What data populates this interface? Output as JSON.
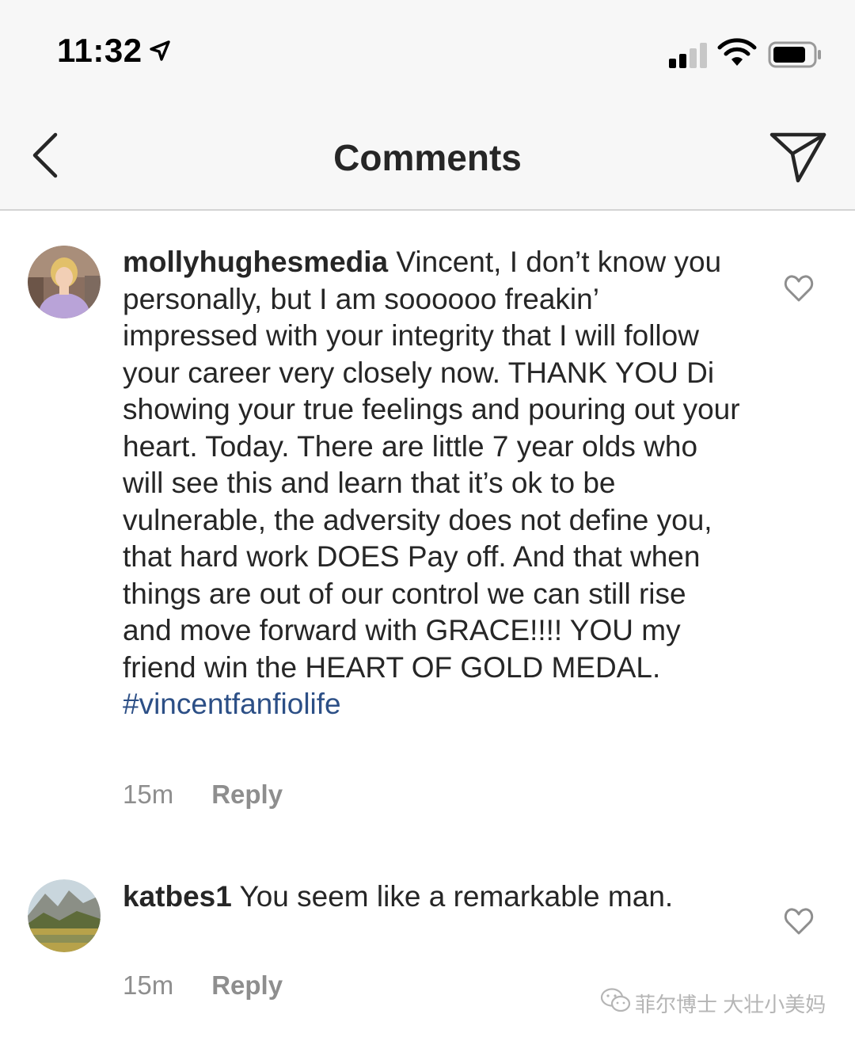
{
  "status_bar": {
    "time": "11:32"
  },
  "nav": {
    "title": "Comments"
  },
  "comments": [
    {
      "username": "mollyhughesmedia",
      "text": "Vincent, I don’t know you personally, but I am soooooo freakin’ impressed with your integrity that I will follow your career very closely now. THANK YOU Di showing your true feelings and pouring out your heart. Today. There are little 7 year olds who will see this and learn that it’s ok to be vulnerable, the adversity does not define you, that hard work DOES Pay off. And that when things are out of our control we can still rise and move forward with GRACE!!!! YOU my friend win the HEART OF GOLD MEDAL.",
      "hashtag": "#vincentfanfiolife",
      "time": "15m",
      "reply_label": "Reply"
    },
    {
      "username": "katbes1",
      "text": "You seem like a remarkable man.",
      "time": "15m",
      "reply_label": "Reply"
    }
  ],
  "watermark": {
    "text": "菲尔博士 大壮小美妈"
  },
  "colors": {
    "hashtag": "#2c4f86",
    "meta": "#8e8e8e",
    "text": "#262626",
    "bar_bg": "#f7f7f7"
  },
  "icons": [
    "location-arrow-icon",
    "cellular-signal-icon",
    "wifi-icon",
    "battery-icon",
    "back-chevron-icon",
    "direct-message-icon",
    "heart-icon",
    "wechat-icon"
  ]
}
